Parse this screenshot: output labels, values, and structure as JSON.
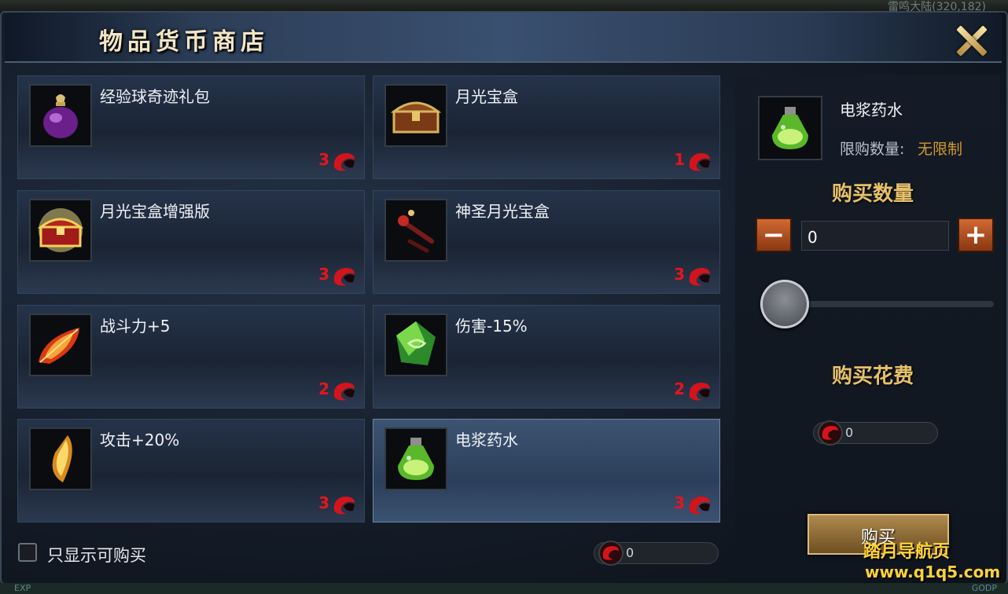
{
  "world": {
    "location": "雷鸣大陆(320,182)"
  },
  "window": {
    "title": "物品货币商店"
  },
  "items": [
    {
      "name": "经验球奇迹礼包",
      "price": "3",
      "icon": "purple-bag-icon"
    },
    {
      "name": "月光宝盒",
      "price": "1",
      "icon": "treasure-chest-icon"
    },
    {
      "name": "月光宝盒增强版",
      "price": "3",
      "icon": "glowing-chest-icon"
    },
    {
      "name": "神圣月光宝盒",
      "price": "3",
      "icon": "holy-wand-icon"
    },
    {
      "name": "战斗力+5",
      "price": "2",
      "icon": "fire-feather-icon"
    },
    {
      "name": "伤害-15%",
      "price": "2",
      "icon": "green-crystal-icon"
    },
    {
      "name": "攻击+20%",
      "price": "3",
      "icon": "gold-shard-icon"
    },
    {
      "name": "电浆药水",
      "price": "3",
      "icon": "green-potion-icon"
    }
  ],
  "selected": {
    "name": "电浆药水",
    "limit_label": "限购数量:",
    "limit_value": "无限制",
    "icon": "green-potion-icon"
  },
  "purchase": {
    "qty_title": "购买数量",
    "qty_value": "0",
    "minus": "−",
    "plus": "+",
    "cost_title": "购买花费",
    "cost_value": "0",
    "buy_label": "购买"
  },
  "filter": {
    "label": "只显示可购买",
    "checked": false
  },
  "balance": {
    "value": "0"
  },
  "watermark": {
    "line1": "踏月导航页",
    "line2": "www.q1q5.com"
  },
  "hud": {
    "exp": "EXP",
    "godp": "GODP"
  },
  "colors": {
    "price": "#e8141c",
    "accent": "#e6c06a",
    "limit": "#d39a2e"
  }
}
